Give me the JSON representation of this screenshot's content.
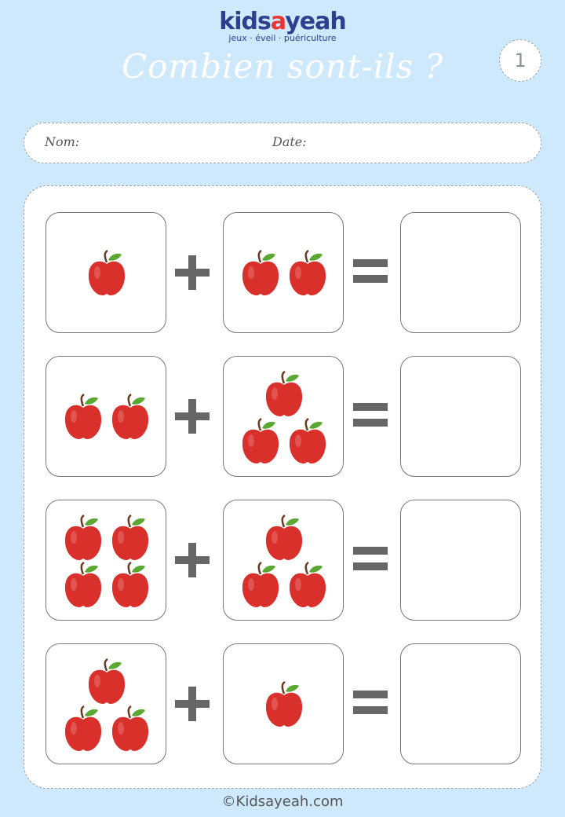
{
  "brand": {
    "name_part1": "kids",
    "name_part2": "a",
    "name_part3": "yeah",
    "tagline": "jeux · éveil · puériculture",
    "color_primary": "#2d3f8e",
    "color_accent": "#e8352f"
  },
  "page": {
    "title": "Combien sont-ils ?",
    "number": "1"
  },
  "student_fields": {
    "name_label": "Nom:",
    "date_label": "Date:"
  },
  "operators": {
    "plus": "+",
    "equals": "="
  },
  "exercises": [
    {
      "left_count": 1,
      "right_count": 2,
      "answer": ""
    },
    {
      "left_count": 2,
      "right_count": 3,
      "answer": ""
    },
    {
      "left_count": 4,
      "right_count": 3,
      "answer": ""
    },
    {
      "left_count": 3,
      "right_count": 1,
      "answer": ""
    }
  ],
  "item_icon": "apple-icon",
  "colors": {
    "background": "#cde9fb",
    "apple": "#d9302c",
    "leaf": "#5aa832",
    "operator": "#666666"
  },
  "footer": {
    "copyright": "©Kidsayeah.com"
  }
}
